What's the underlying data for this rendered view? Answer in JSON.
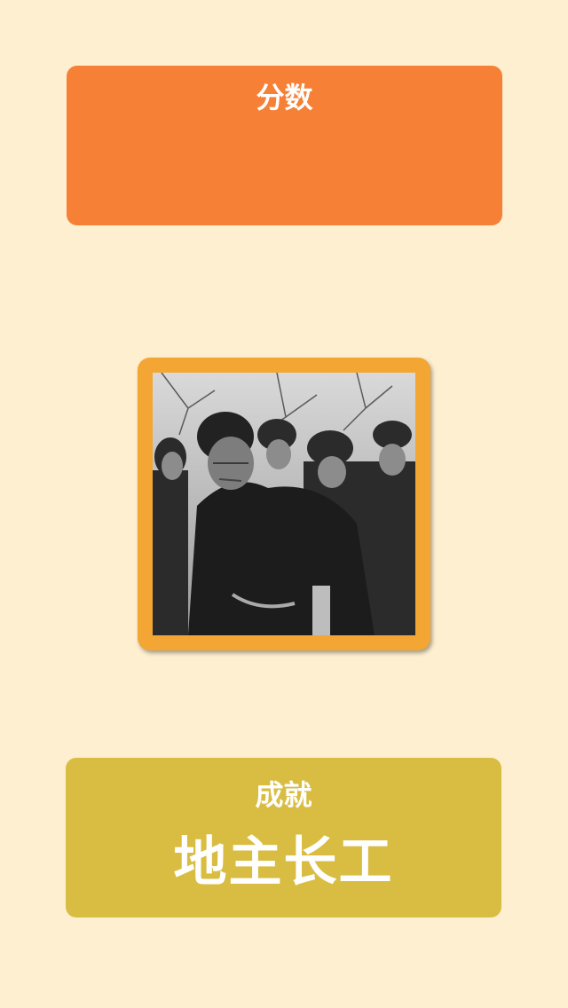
{
  "score": {
    "label": "分数",
    "value": ""
  },
  "photo": {
    "description_icon": "photo-image"
  },
  "achievement": {
    "label": "成就",
    "value": "地主长工"
  },
  "colors": {
    "background": "#FDEFD0",
    "score_card": "#F58036",
    "photo_frame": "#F3A633",
    "achievement_card": "#D9BD42",
    "text": "#FFFFFF"
  }
}
